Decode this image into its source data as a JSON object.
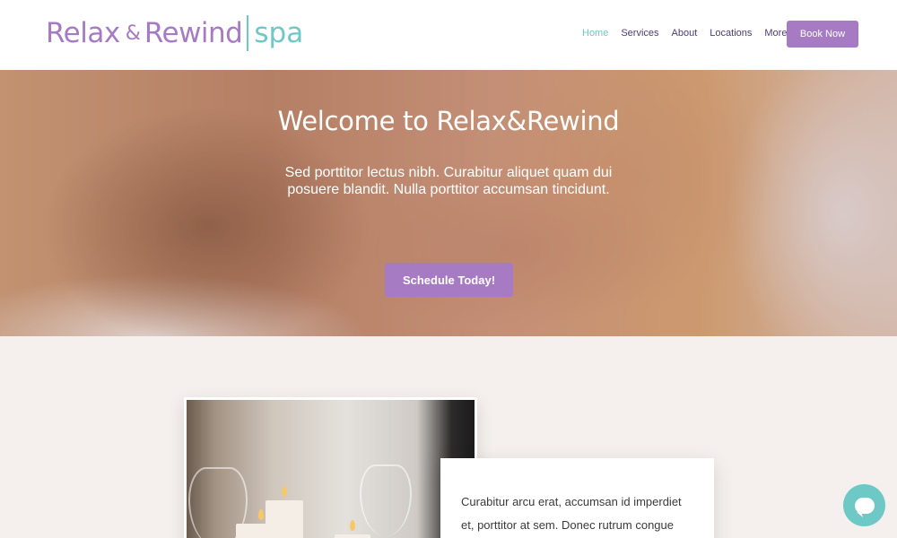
{
  "brand": {
    "name_part1": "Relax",
    "ampersand": "&",
    "name_part2": "Rewind",
    "suffix": "spa",
    "color_primary": "#a77bc4",
    "color_accent": "#6ec8c6"
  },
  "nav": {
    "items": [
      {
        "label": "Home",
        "active": true
      },
      {
        "label": "Services",
        "active": false
      },
      {
        "label": "About",
        "active": false
      },
      {
        "label": "Locations",
        "active": false
      },
      {
        "label": "More",
        "active": false
      }
    ],
    "cta_label": "Book Now"
  },
  "hero": {
    "title": "Welcome to Relax&Rewind",
    "text": "Sed porttitor lectus nibh. Curabitur aliquet quam dui posuere blandit. Nulla porttitor accumsan tincidunt.",
    "button_label": "Schedule Today!"
  },
  "feature": {
    "card_text": "Curabitur arcu erat, accumsan id imperdiet et, porttitor at sem. Donec rutrum congue"
  },
  "chat": {
    "icon": "chat-bubble-icon"
  }
}
